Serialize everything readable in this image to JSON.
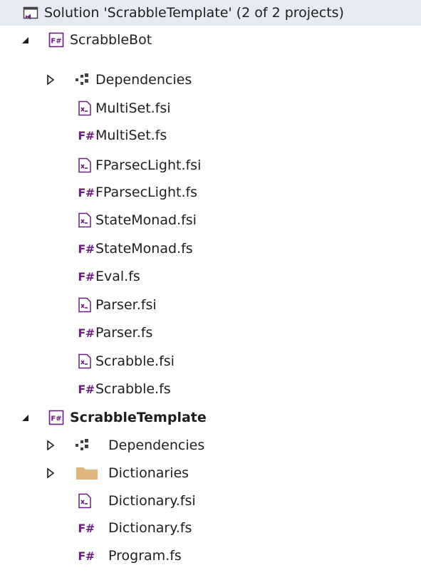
{
  "solution": {
    "label": "Solution 'ScrabbleTemplate' (2 of 2 projects)"
  },
  "projects": [
    {
      "name": "ScrabbleBot",
      "bold": false,
      "icon_text": "F#",
      "expanded": true,
      "items": [
        {
          "label": "Dependencies",
          "icon": "dependencies-icon",
          "expander": "collapsed"
        },
        {
          "label": "MultiSet.fsi",
          "icon": "fsi-file-icon"
        },
        {
          "label": "MultiSet.fs",
          "icon": "fs-file-icon"
        },
        {
          "label": "FParsecLight.fsi",
          "icon": "fsi-file-icon"
        },
        {
          "label": "FParsecLight.fs",
          "icon": "fs-file-icon"
        },
        {
          "label": "StateMonad.fsi",
          "icon": "fsi-file-icon"
        },
        {
          "label": "StateMonad.fs",
          "icon": "fs-file-icon"
        },
        {
          "label": "Eval.fs",
          "icon": "fs-file-icon"
        },
        {
          "label": "Parser.fsi",
          "icon": "fsi-file-icon"
        },
        {
          "label": "Parser.fs",
          "icon": "fs-file-icon"
        },
        {
          "label": "Scrabble.fsi",
          "icon": "fsi-file-icon"
        },
        {
          "label": "Scrabble.fs",
          "icon": "fs-file-icon"
        }
      ]
    },
    {
      "name": "ScrabbleTemplate",
      "bold": true,
      "icon_text": "F#",
      "expanded": true,
      "items": [
        {
          "label": "Dependencies",
          "icon": "dependencies-icon",
          "expander": "collapsed"
        },
        {
          "label": "Dictionaries",
          "icon": "folder-icon",
          "expander": "collapsed"
        },
        {
          "label": "Dictionary.fsi",
          "icon": "fsi-file-icon"
        },
        {
          "label": "Dictionary.fs",
          "icon": "fs-file-icon"
        },
        {
          "label": "Program.fs",
          "icon": "fs-file-icon"
        }
      ]
    }
  ],
  "fs_icon_text": "F#",
  "colors": {
    "selection": "#e5eaf3",
    "fsharp_purple": "#68217a",
    "folder": "#dcb67a",
    "text": "#1e1e1e"
  }
}
